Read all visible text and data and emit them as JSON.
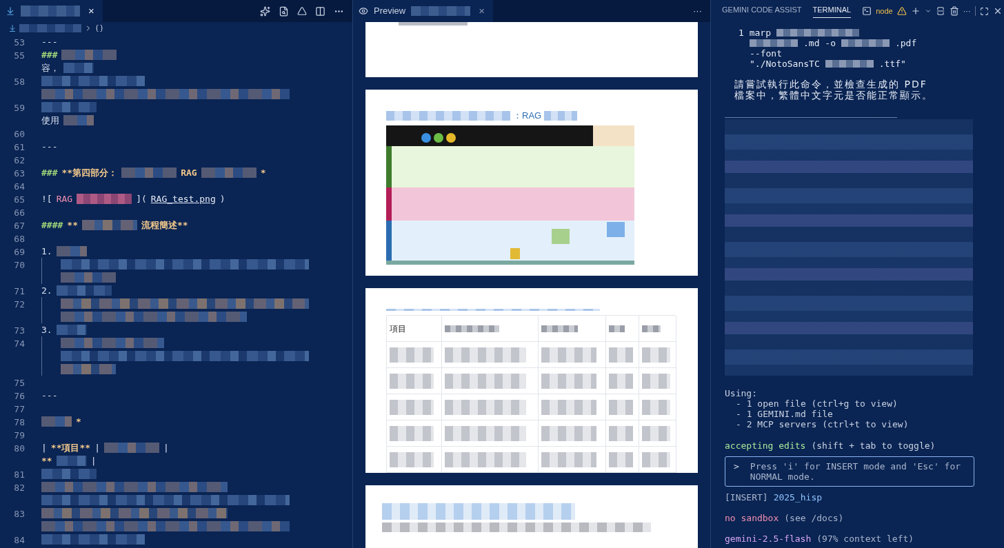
{
  "editor": {
    "tab": {
      "close": "×"
    },
    "rows": [
      {
        "number": "53",
        "parts": [
          {
            "kind": "plain",
            "text": "---"
          }
        ]
      },
      {
        "number": "55",
        "parts": [
          {
            "kind": "marker",
            "text": "###"
          },
          {
            "kind": "redacted"
          }
        ]
      },
      {
        "parts": [
          {
            "kind": "plain",
            "text": "容，"
          },
          {
            "kind": "redacted"
          }
        ]
      },
      {
        "number": "58",
        "parts": [
          {
            "kind": "redacted"
          }
        ]
      },
      {
        "parts": [
          {
            "kind": "redacted"
          }
        ]
      },
      {
        "number": "59",
        "parts": [
          {
            "kind": "redacted"
          }
        ]
      },
      {
        "parts": [
          {
            "kind": "plain",
            "text": "使用"
          },
          {
            "kind": "redacted"
          }
        ]
      },
      {
        "number": "60",
        "parts": []
      },
      {
        "number": "61",
        "parts": [
          {
            "kind": "plain",
            "text": "---"
          }
        ]
      },
      {
        "number": "62",
        "parts": []
      },
      {
        "number": "63",
        "parts": [
          {
            "kind": "marker",
            "text": "###"
          },
          {
            "kind": "heading",
            "text": "**第四部分："
          },
          {
            "kind": "redacted"
          },
          {
            "kind": "heading",
            "text": "RAG"
          },
          {
            "kind": "redacted"
          },
          {
            "kind": "heading",
            "text": "*"
          }
        ]
      },
      {
        "number": "64",
        "parts": []
      },
      {
        "number": "65",
        "parts": [
          {
            "kind": "plain",
            "text": "!["
          },
          {
            "kind": "link",
            "text": "RAG"
          },
          {
            "kind": "redacted"
          },
          {
            "kind": "plain",
            "text": "]("
          },
          {
            "kind": "url",
            "text": "RAG_test.png"
          },
          {
            "kind": "plain",
            "text": ")"
          }
        ]
      },
      {
        "number": "66",
        "parts": []
      },
      {
        "number": "67",
        "parts": [
          {
            "kind": "marker",
            "text": "####"
          },
          {
            "kind": "heading",
            "text": "**"
          },
          {
            "kind": "redacted"
          },
          {
            "kind": "heading",
            "text": "流程簡述**"
          }
        ]
      },
      {
        "number": "68",
        "parts": []
      },
      {
        "number": "69",
        "parts": [
          {
            "kind": "plain",
            "text": "1."
          },
          {
            "kind": "redacted"
          }
        ]
      },
      {
        "number": "70",
        "parts": [
          {
            "kind": "indent"
          },
          {
            "kind": "redacted"
          }
        ]
      },
      {
        "parts": [
          {
            "kind": "indent"
          },
          {
            "kind": "redacted"
          }
        ]
      },
      {
        "number": "71",
        "parts": [
          {
            "kind": "plain",
            "text": "2."
          },
          {
            "kind": "redacted"
          }
        ]
      },
      {
        "number": "72",
        "parts": [
          {
            "kind": "indent"
          },
          {
            "kind": "redacted"
          }
        ]
      },
      {
        "parts": [
          {
            "kind": "indent"
          },
          {
            "kind": "redacted"
          }
        ]
      },
      {
        "number": "73",
        "parts": [
          {
            "kind": "plain",
            "text": "3."
          },
          {
            "kind": "redacted"
          }
        ]
      },
      {
        "number": "74",
        "parts": [
          {
            "kind": "indent"
          },
          {
            "kind": "redacted"
          }
        ]
      },
      {
        "parts": [
          {
            "kind": "indent"
          },
          {
            "kind": "redacted"
          }
        ]
      },
      {
        "parts": [
          {
            "kind": "indent"
          },
          {
            "kind": "redacted"
          }
        ]
      },
      {
        "number": "75",
        "parts": []
      },
      {
        "number": "76",
        "parts": [
          {
            "kind": "plain",
            "text": "---"
          }
        ]
      },
      {
        "number": "77",
        "parts": []
      },
      {
        "number": "78",
        "parts": [
          {
            "kind": "redacted"
          },
          {
            "kind": "heading",
            "text": "*"
          }
        ]
      },
      {
        "number": "79",
        "parts": []
      },
      {
        "number": "80",
        "parts": [
          {
            "kind": "plain",
            "text": "|"
          },
          {
            "kind": "heading",
            "text": "**項目**"
          },
          {
            "kind": "plain",
            "text": "|"
          },
          {
            "kind": "redacted"
          },
          {
            "kind": "plain",
            "text": "|"
          }
        ]
      },
      {
        "parts": [
          {
            "kind": "heading",
            "text": "**"
          },
          {
            "kind": "redacted"
          },
          {
            "kind": "plain",
            "text": "|"
          }
        ]
      },
      {
        "number": "81",
        "parts": [
          {
            "kind": "redacted"
          }
        ]
      },
      {
        "number": "82",
        "parts": [
          {
            "kind": "redacted"
          }
        ]
      },
      {
        "parts": [
          {
            "kind": "redacted"
          }
        ]
      },
      {
        "number": "83",
        "parts": [
          {
            "kind": "redacted"
          }
        ]
      },
      {
        "parts": [
          {
            "kind": "redacted"
          }
        ]
      },
      {
        "number": "84",
        "parts": [
          {
            "kind": "redacted"
          }
        ]
      }
    ]
  },
  "preview": {
    "tab": {
      "label": "Preview",
      "close": "×"
    },
    "more": "···",
    "pages": [
      {
        "kind": "blank"
      },
      {
        "kind": "figure",
        "heading": "：RAG"
      },
      {
        "kind": "table",
        "header": "項目"
      },
      {
        "kind": "blurred"
      }
    ]
  },
  "terminal": {
    "tabs": [
      {
        "label": "GEMINI CODE ASSIST",
        "selected": false
      },
      {
        "label": "TERMINAL",
        "selected": true
      }
    ],
    "shell": "node",
    "more": "···",
    "command": [
      {
        "parts": [
          {
            "kind": "text",
            "text": "1 marp"
          },
          {
            "kind": "redacted"
          }
        ]
      },
      {
        "parts": [
          {
            "kind": "redacted"
          },
          {
            "kind": "text",
            "text": ".md -o"
          },
          {
            "kind": "redacted"
          },
          {
            "kind": "text",
            "text": ".pdf"
          }
        ]
      },
      {
        "parts": [
          {
            "kind": "text",
            "text": "--font"
          }
        ]
      },
      {
        "parts": [
          {
            "kind": "text",
            "text": "\"./NotoSansTC"
          },
          {
            "kind": "redacted"
          },
          {
            "kind": "text",
            "text": ".ttf\""
          }
        ]
      }
    ],
    "message": [
      "請嘗試執行此命令，並檢查生成的 PDF",
      "檔案中，繁體中文字元是否能正常顯示。"
    ],
    "using": {
      "title": "Using:",
      "items": [
        "- 1 open file (ctrl+g to view)",
        "- 1 GEMINI.md file",
        "- 2 MCP servers (ctrl+t to view)"
      ]
    },
    "mode": {
      "label": "accepting edits",
      "hint": "(shift + tab to toggle)"
    },
    "input": {
      "prompt": ">",
      "placeholder": "Press 'i' for INSERT mode and 'Esc' for NORMAL mode."
    },
    "vim": {
      "mode": "[INSERT]",
      "dir": "2025_hisp"
    },
    "sandbox": {
      "label": "no sandbox",
      "hint": "(see /docs)"
    },
    "model": {
      "label": "gemini-2.5-flash",
      "hint": "(97% context left)"
    }
  }
}
